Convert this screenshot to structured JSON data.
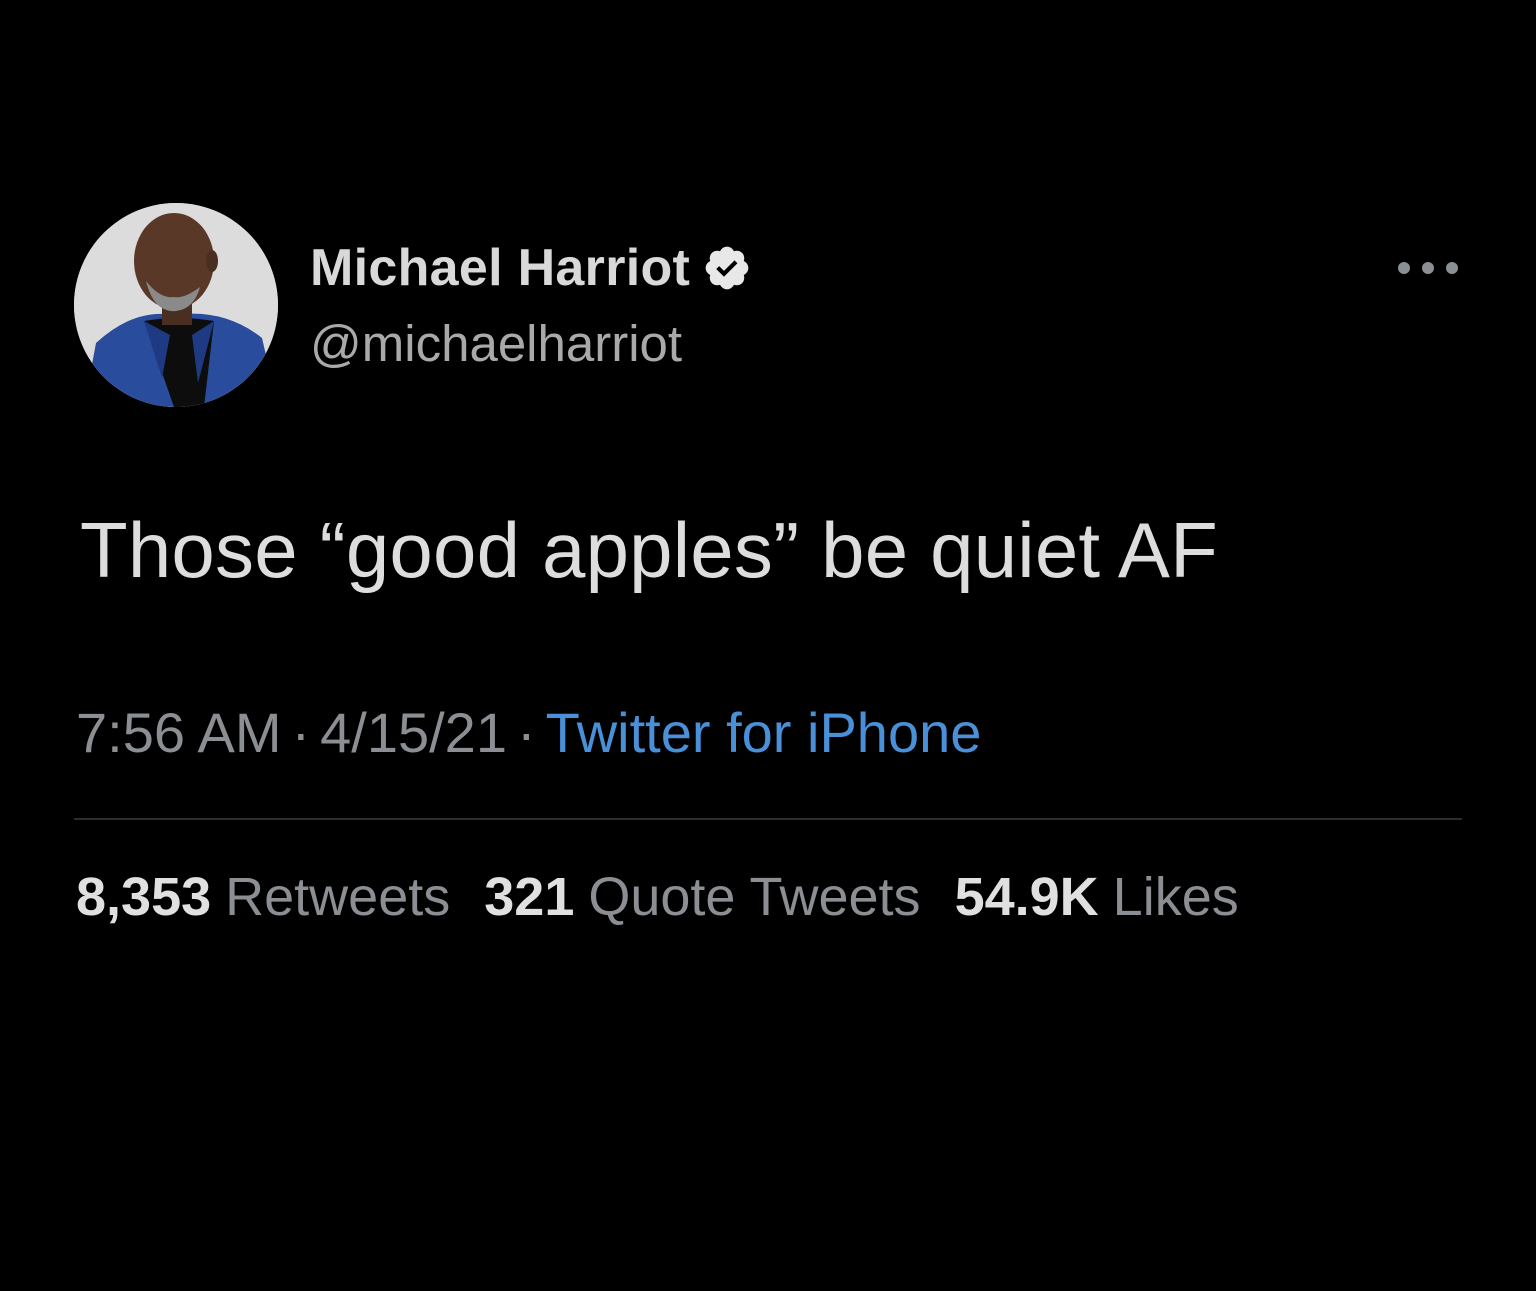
{
  "author": {
    "display_name": "Michael Harriot",
    "handle": "@michaelharriot",
    "verified": true,
    "avatar": "profile-photo"
  },
  "more_icon": "more-horizontal-icon",
  "tweet": {
    "text": "Those “good apples” be quiet AF"
  },
  "meta": {
    "time": "7:56 AM",
    "separator": "·",
    "date": "4/15/21",
    "source": "Twitter for iPhone"
  },
  "stats": {
    "retweets_count": "8,353",
    "retweets_label": "Retweets",
    "quotes_count": "321",
    "quotes_label": "Quote Tweets",
    "likes_count": "54.9K",
    "likes_label": "Likes"
  },
  "colors": {
    "background": "#000000",
    "link": "#4a90d9",
    "muted": "#8b8e92",
    "verified_badge": "#e8e8e8"
  }
}
